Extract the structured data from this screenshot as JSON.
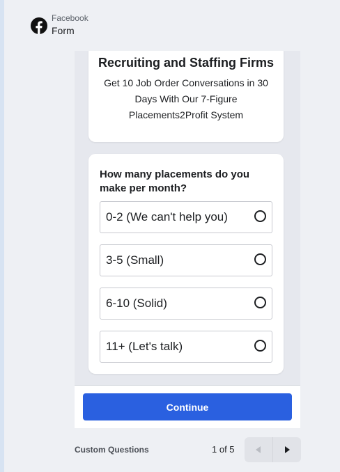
{
  "header": {
    "brand": "Facebook",
    "form_label": "Form"
  },
  "intro": {
    "title": "Recruiting and Staffing Firms",
    "description": "Get 10 Job Order Conversations in 30 Days With Our 7-Figure Placements2Profit System"
  },
  "question": {
    "title": "How many placements do you make per month?",
    "options": [
      {
        "label": "0-2 (We can't help you)",
        "selected": false
      },
      {
        "label": "3-5 (Small)",
        "selected": false
      },
      {
        "label": "6-10 (Solid)",
        "selected": false
      },
      {
        "label": "11+ (Let's talk)",
        "selected": false
      }
    ]
  },
  "footer": {
    "continue_label": "Continue"
  },
  "pager": {
    "section_label": "Custom Questions",
    "page_text": "1 of 5",
    "prev_icon": "triangle-left-icon",
    "next_icon": "triangle-right-icon"
  },
  "colors": {
    "primary": "#2a60e0",
    "page_bg": "#eef0f4",
    "phone_bg": "#e6e8ee"
  }
}
